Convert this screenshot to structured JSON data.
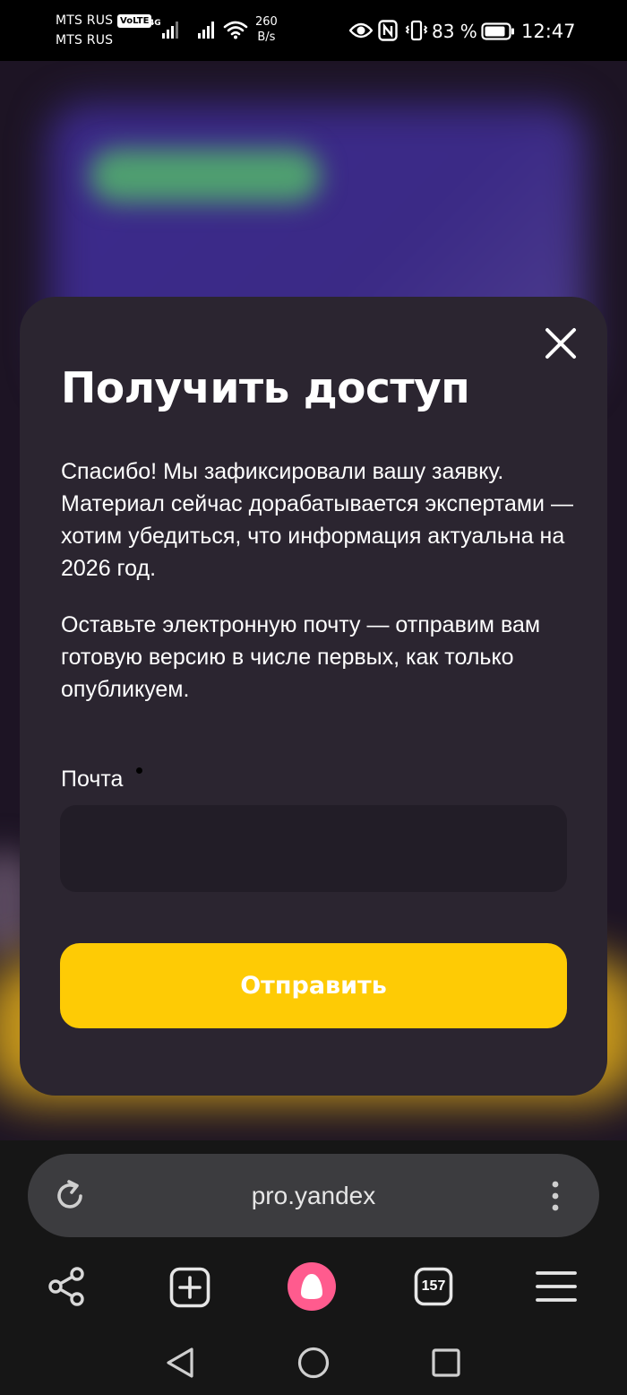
{
  "status_bar": {
    "carrier1": "MTS RUS",
    "carrier2": "MTS RUS",
    "volte": "VoLTE",
    "network_type": "4G",
    "net_speed_value": "260",
    "net_speed_unit": "B/s",
    "battery_percent": "83 %",
    "time": "12:47"
  },
  "modal": {
    "title": "Получить доступ",
    "paragraph1": "Спасибо! Мы зафиксировали вашу заявку. Материал сейчас дорабатывается экспертами — хотим убедиться, что информация актуальна на 2026 год.",
    "paragraph2": "Оставьте электронную почту — отправим вам готовую версию в числе первых, как только опубликуем.",
    "email_label": "Почта",
    "email_value": "",
    "email_placeholder": "",
    "submit_label": "Отправить",
    "close_icon": "close-icon"
  },
  "browser": {
    "url": "pro.yandex",
    "tabs_count": "157",
    "icons": [
      "reload-icon",
      "more-vertical-icon",
      "share-icon",
      "new-tab-icon",
      "alice-icon",
      "tabs-icon",
      "menu-icon"
    ]
  },
  "system_nav": {
    "icons": [
      "back-icon",
      "home-icon",
      "recents-icon"
    ]
  },
  "colors": {
    "modal_bg": "#2b2530",
    "input_bg": "#221d27",
    "accent_yellow": "#fecb05",
    "alice_pink": "#ff5b8e",
    "browser_bar_bg": "#161616",
    "address_bar_bg": "#3c3c3f"
  }
}
